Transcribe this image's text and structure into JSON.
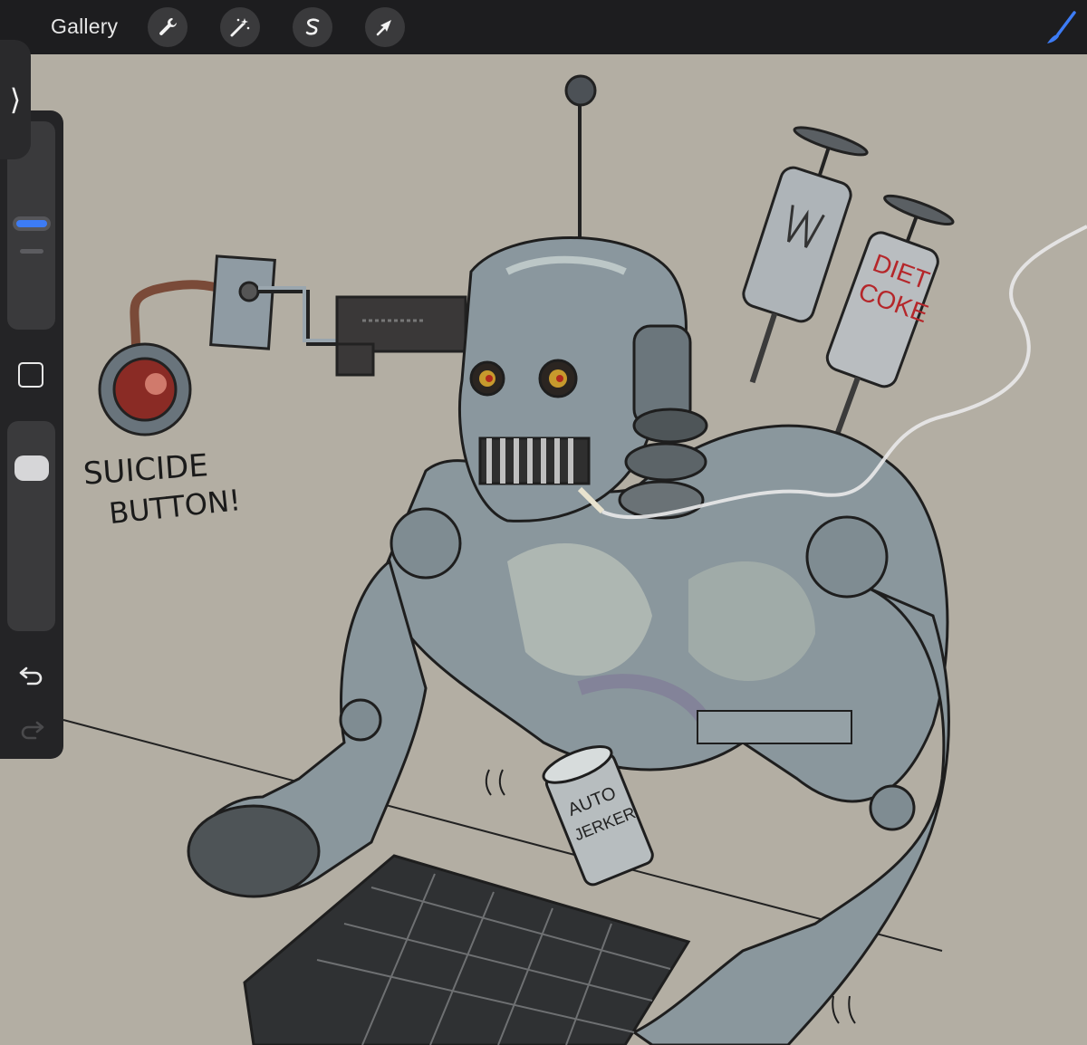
{
  "toolbar": {
    "gallery_label": "Gallery",
    "tools": [
      {
        "name": "actions",
        "icon": "wrench-icon"
      },
      {
        "name": "adjustments",
        "icon": "magic-wand-icon"
      },
      {
        "name": "selection",
        "icon": "selection-s-icon"
      },
      {
        "name": "transform",
        "icon": "arrow-cursor-icon"
      }
    ],
    "active_tool_icon": "paintbrush-icon",
    "accent_color": "#3d7cf5"
  },
  "sidebar": {
    "toggle_icon": "chevron-right-icon",
    "size_slider_level": 0.48,
    "opacity_slider_level": 0.85,
    "modify_button_icon": "square-icon",
    "undo_icon": "undo-arrow-icon",
    "redo_icon": "redo-arrow-icon"
  },
  "canvas": {
    "background_color": "#b3aea3",
    "drawing_labels": {
      "button_label_line1": "SUICIDE",
      "button_label_line2": "BUTTON!",
      "syringe_text_line1": "DIET",
      "syringe_text_line2": "COKE",
      "can_text_line1": "AUTO",
      "can_text_line2": "JERKER"
    }
  }
}
